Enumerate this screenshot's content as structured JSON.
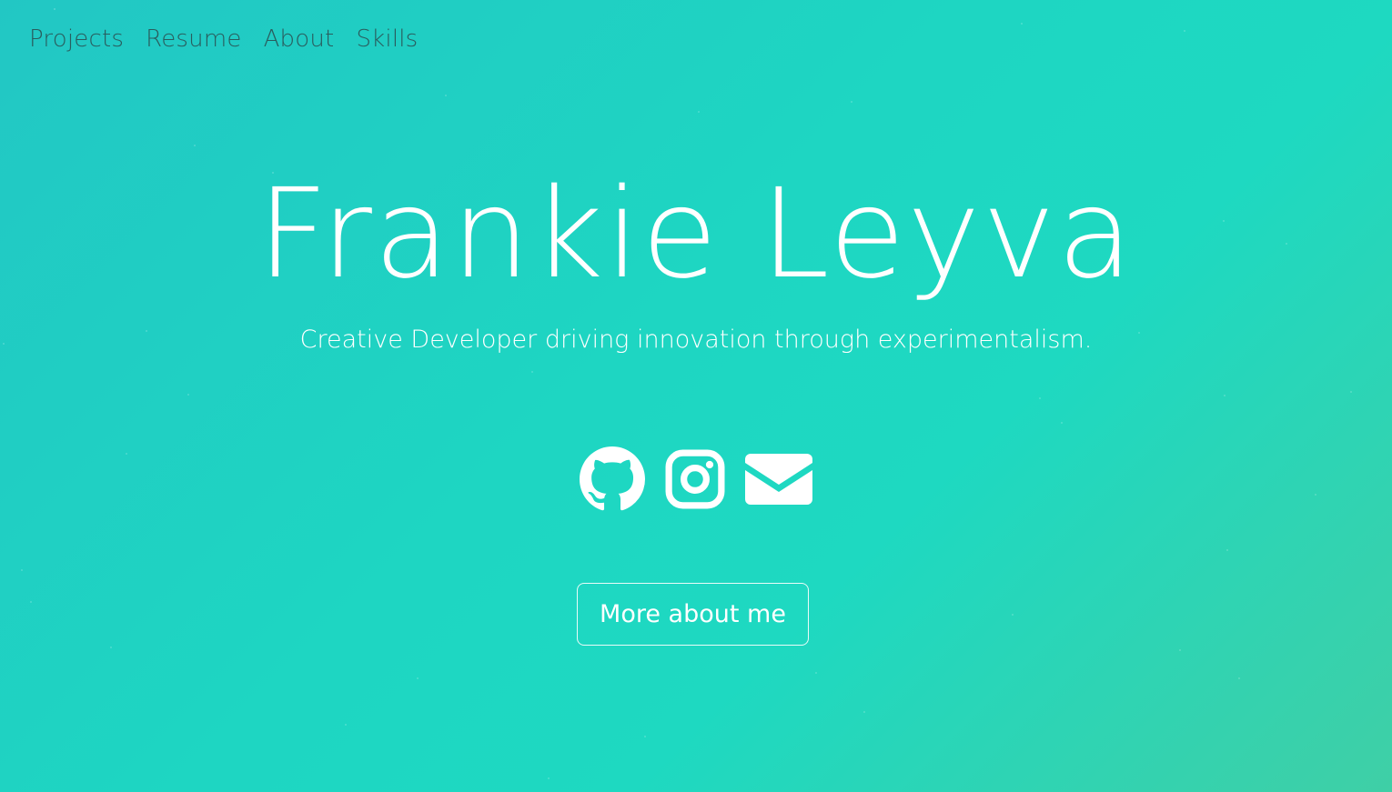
{
  "nav": {
    "items": [
      {
        "label": "Projects"
      },
      {
        "label": "Resume"
      },
      {
        "label": "About"
      },
      {
        "label": "Skills"
      }
    ]
  },
  "hero": {
    "name": "Frankie Leyva",
    "tagline": "Creative Developer driving innovation through experimentalism."
  },
  "socials": [
    {
      "icon": "github-icon"
    },
    {
      "icon": "instagram-icon"
    },
    {
      "icon": "envelope-icon"
    }
  ],
  "cta": {
    "label": "More about me"
  },
  "colors": {
    "background_start": "#22c7c4",
    "background_mid": "#1ed9c1",
    "background_end": "#3fcfa6",
    "nav_text": "#2a5d5e",
    "hero_text": "#ffffff"
  }
}
